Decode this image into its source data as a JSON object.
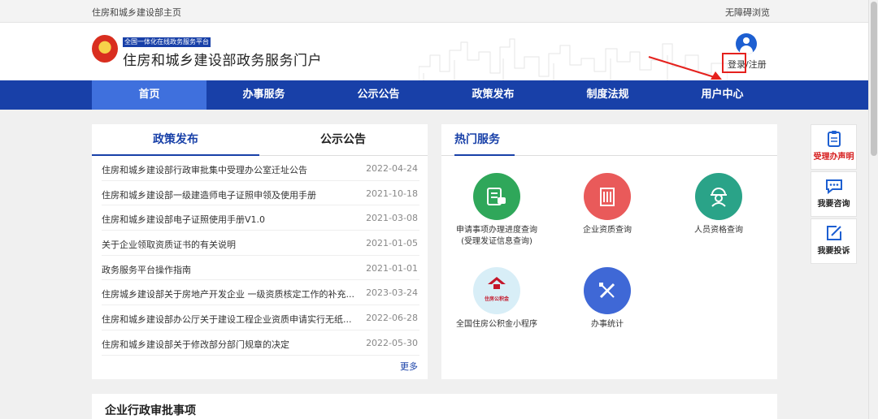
{
  "topbar": {
    "home_link": "住房和城乡建设部主页",
    "accessibility_link": "无障碍浏览"
  },
  "header": {
    "platform_tag": "全国一体化在线政务服务平台",
    "site_title": "住房和城乡建设部政务服务门户",
    "login": "登录",
    "separator": "/",
    "register": "注册"
  },
  "nav": {
    "items": [
      {
        "label": "首页"
      },
      {
        "label": "办事服务"
      },
      {
        "label": "公示公告"
      },
      {
        "label": "政策发布"
      },
      {
        "label": "制度法规"
      },
      {
        "label": "用户中心"
      }
    ]
  },
  "policy_panel": {
    "tabs": [
      {
        "label": "政策发布"
      },
      {
        "label": "公示公告"
      }
    ],
    "items": [
      {
        "title": "住房和城乡建设部行政审批集中受理办公室迁址公告",
        "date": "2022-04-24"
      },
      {
        "title": "住房和城乡建设部一级建造师电子证照申领及使用手册",
        "date": "2021-10-18"
      },
      {
        "title": "住房和城乡建设部电子证照使用手册V1.0",
        "date": "2021-03-08"
      },
      {
        "title": "关于企业领取资质证书的有关说明",
        "date": "2021-01-05"
      },
      {
        "title": "政务服务平台操作指南",
        "date": "2021-01-01"
      },
      {
        "title": "住房城乡建设部关于房地产开发企业 一级资质核定工作的补充...",
        "date": "2023-03-24"
      },
      {
        "title": "住房和城乡建设部办公厅关于建设工程企业资质申请实行无纸...",
        "date": "2022-06-28"
      },
      {
        "title": "住房和城乡建设部关于修改部分部门规章的决定",
        "date": "2022-05-30"
      }
    ],
    "more": "更多"
  },
  "hot_services": {
    "title": "热门服务",
    "items": [
      {
        "label": "申请事项办理进度查询\n(受理发证信息查询)",
        "icon": "progress-query-icon",
        "color": "#2fa75a"
      },
      {
        "label": "企业资质查询",
        "icon": "enterprise-building-icon",
        "color": "#e95a5a"
      },
      {
        "label": "人员资格查询",
        "icon": "worker-helmet-icon",
        "color": "#2aa388"
      },
      {
        "label": "全国住房公积金小程序",
        "icon": "housing-fund-logo",
        "color": "#d8eef7",
        "logo_text": "住房公积金"
      },
      {
        "label": "办事统计",
        "icon": "statistics-pencil-icon",
        "color": "#3f68d6"
      }
    ]
  },
  "side_widgets": [
    {
      "label": "受理办声明",
      "icon": "clipboard-icon",
      "accent": "#d61d1d"
    },
    {
      "label": "我要咨询",
      "icon": "chat-bubble-icon",
      "accent": "#222222"
    },
    {
      "label": "我要投诉",
      "icon": "edit-icon",
      "accent": "#222222"
    }
  ],
  "enterprise": {
    "title": "企业行政审批事项"
  },
  "colors": {
    "primary": "#1840a8",
    "nav_active": "#3f70dd",
    "highlight_red": "#e5211d"
  }
}
